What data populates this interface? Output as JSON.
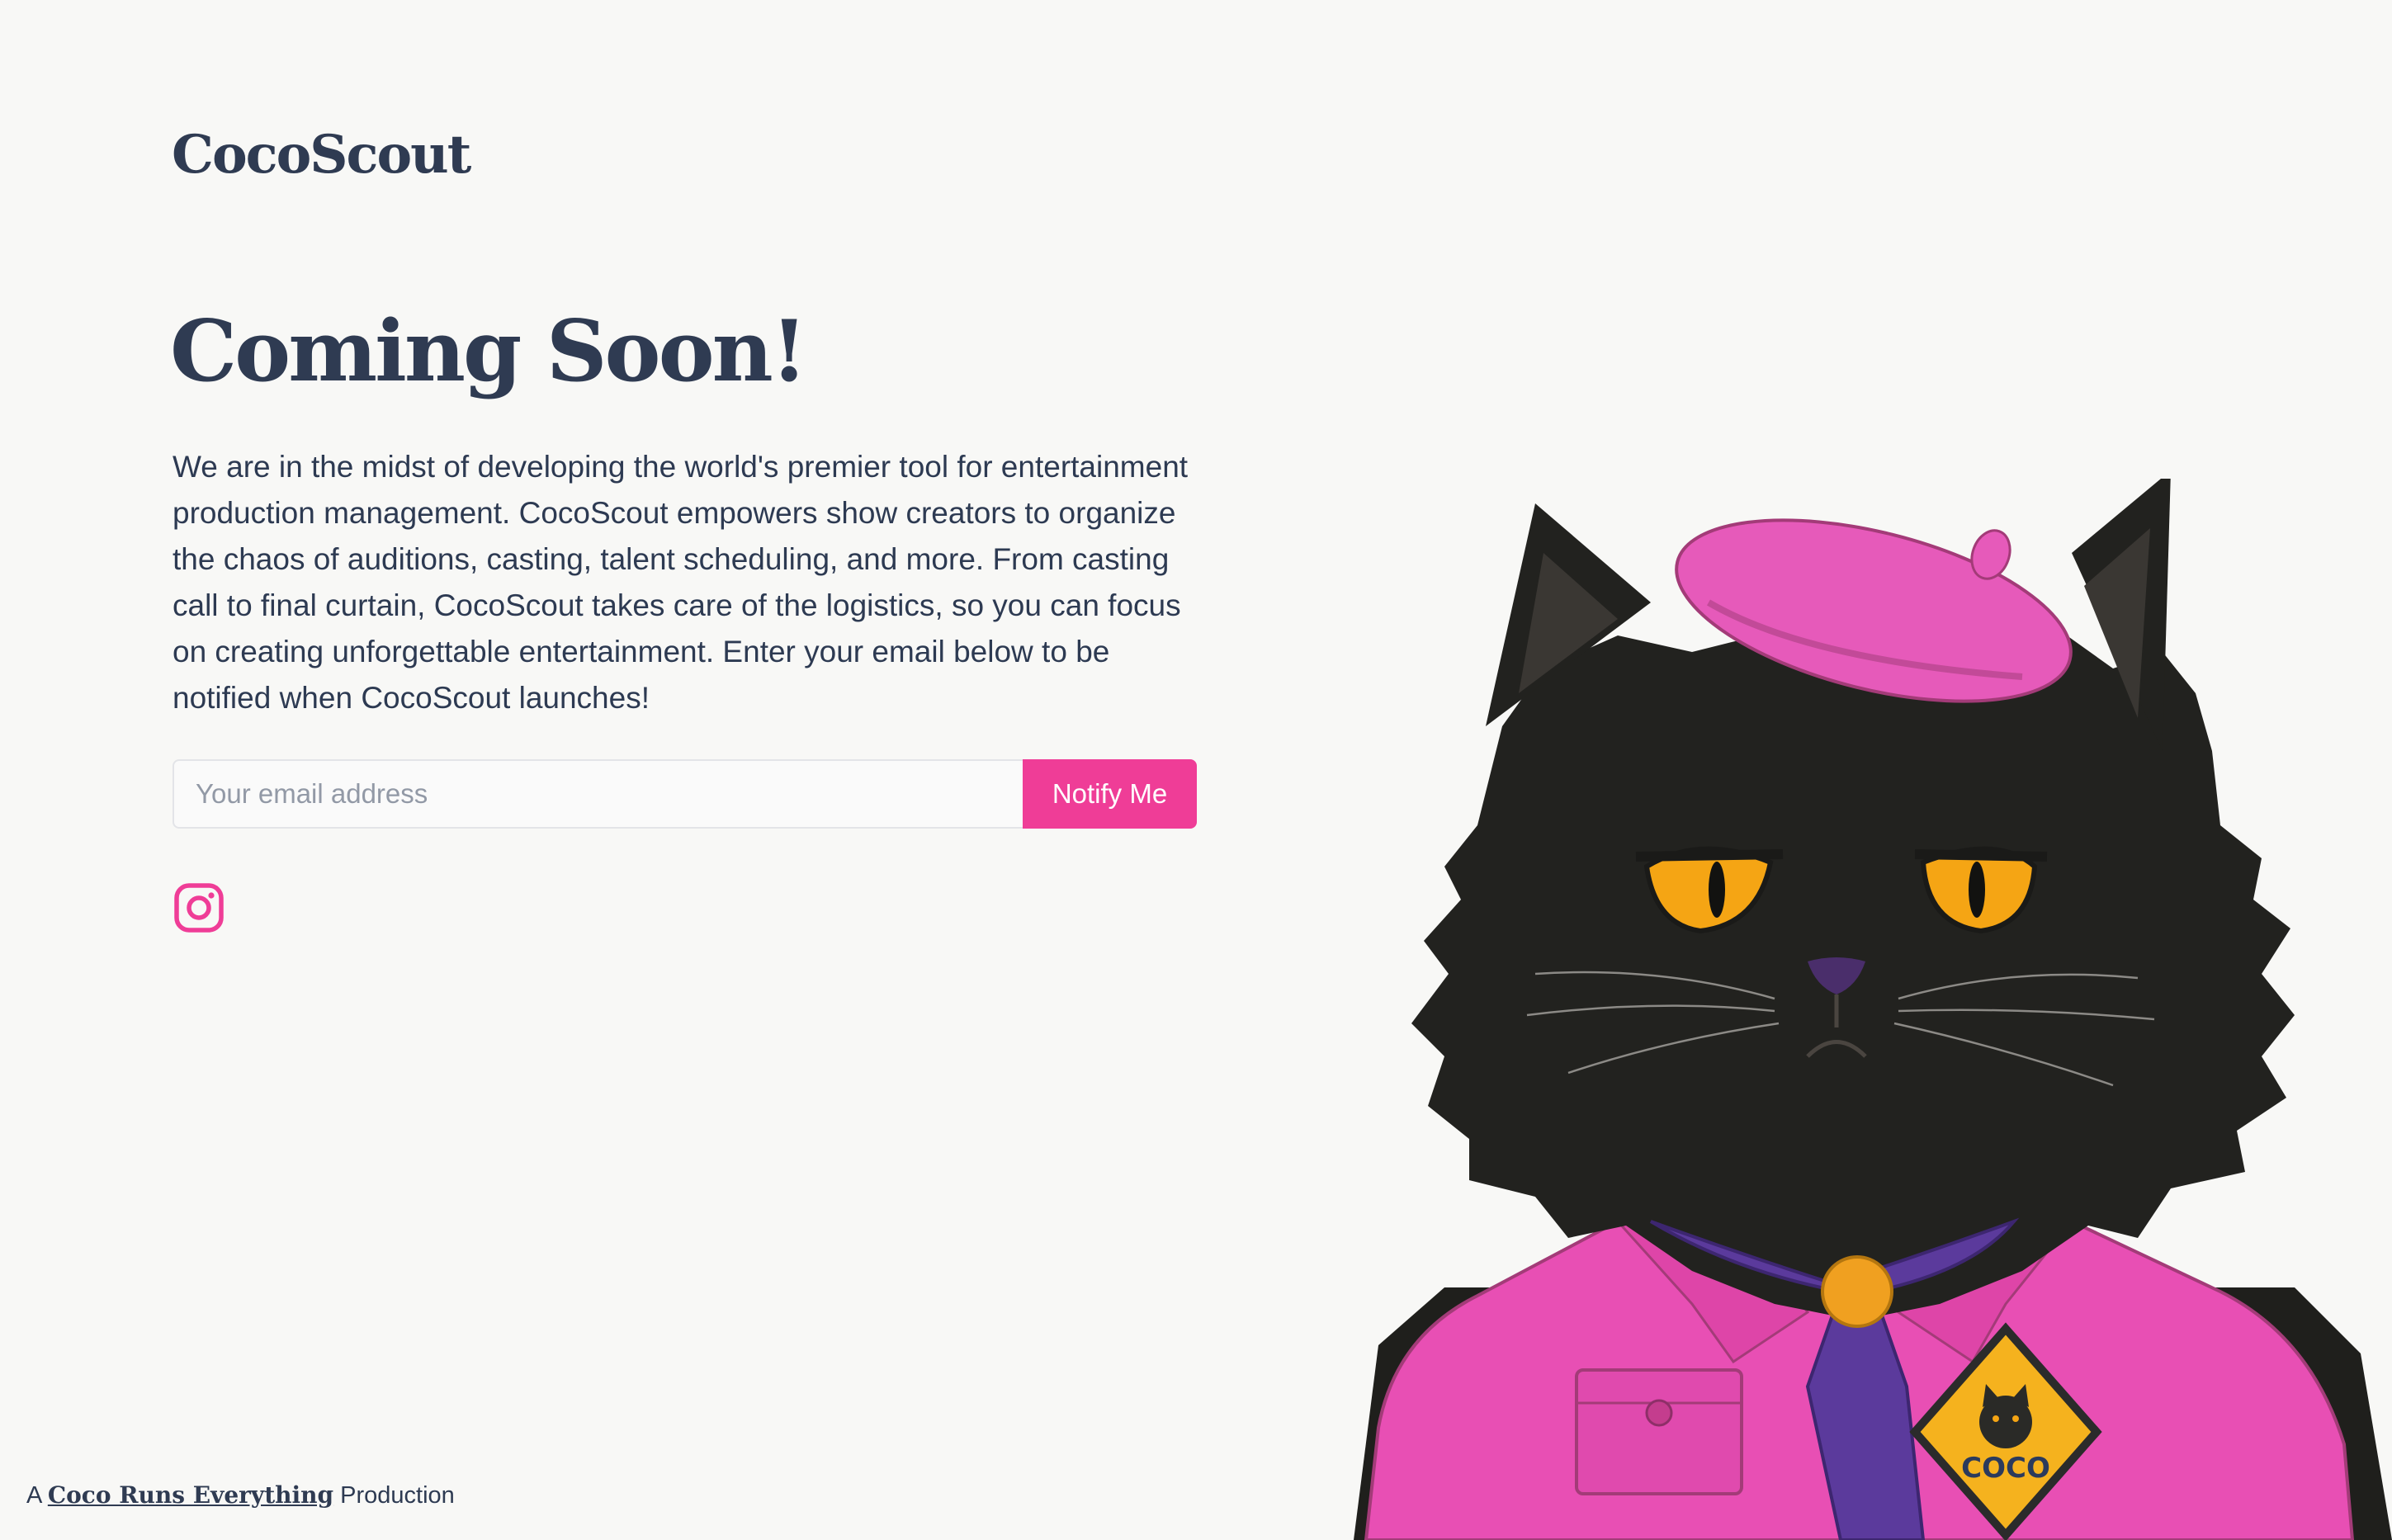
{
  "brand": {
    "name": "CocoScout"
  },
  "hero": {
    "title": "Coming Soon!",
    "description": "We are in the midst of developing the world's premier tool for entertainment production management. CocoScout empowers show creators to organize the chaos of auditions, casting, talent scheduling, and more. From casting call to final curtain, CocoScout takes care of the logistics, so you can focus on creating unforgettable entertainment. Enter your email below to be notified when CocoScout launches!"
  },
  "signup": {
    "email_placeholder": "Your email address",
    "email_value": "",
    "button_label": "Notify Me"
  },
  "social": {
    "icon": "instagram-icon"
  },
  "footer": {
    "prefix": "A",
    "link_text": "Coco Runs Everything",
    "suffix": "Production"
  },
  "illustration": {
    "badge_text": "COCO"
  },
  "colors": {
    "background": "#f8f8f6",
    "text": "#2d3a52",
    "accent": "#ef3d97",
    "scarf": "#5b3a9c",
    "eyes": "#f5a514"
  }
}
